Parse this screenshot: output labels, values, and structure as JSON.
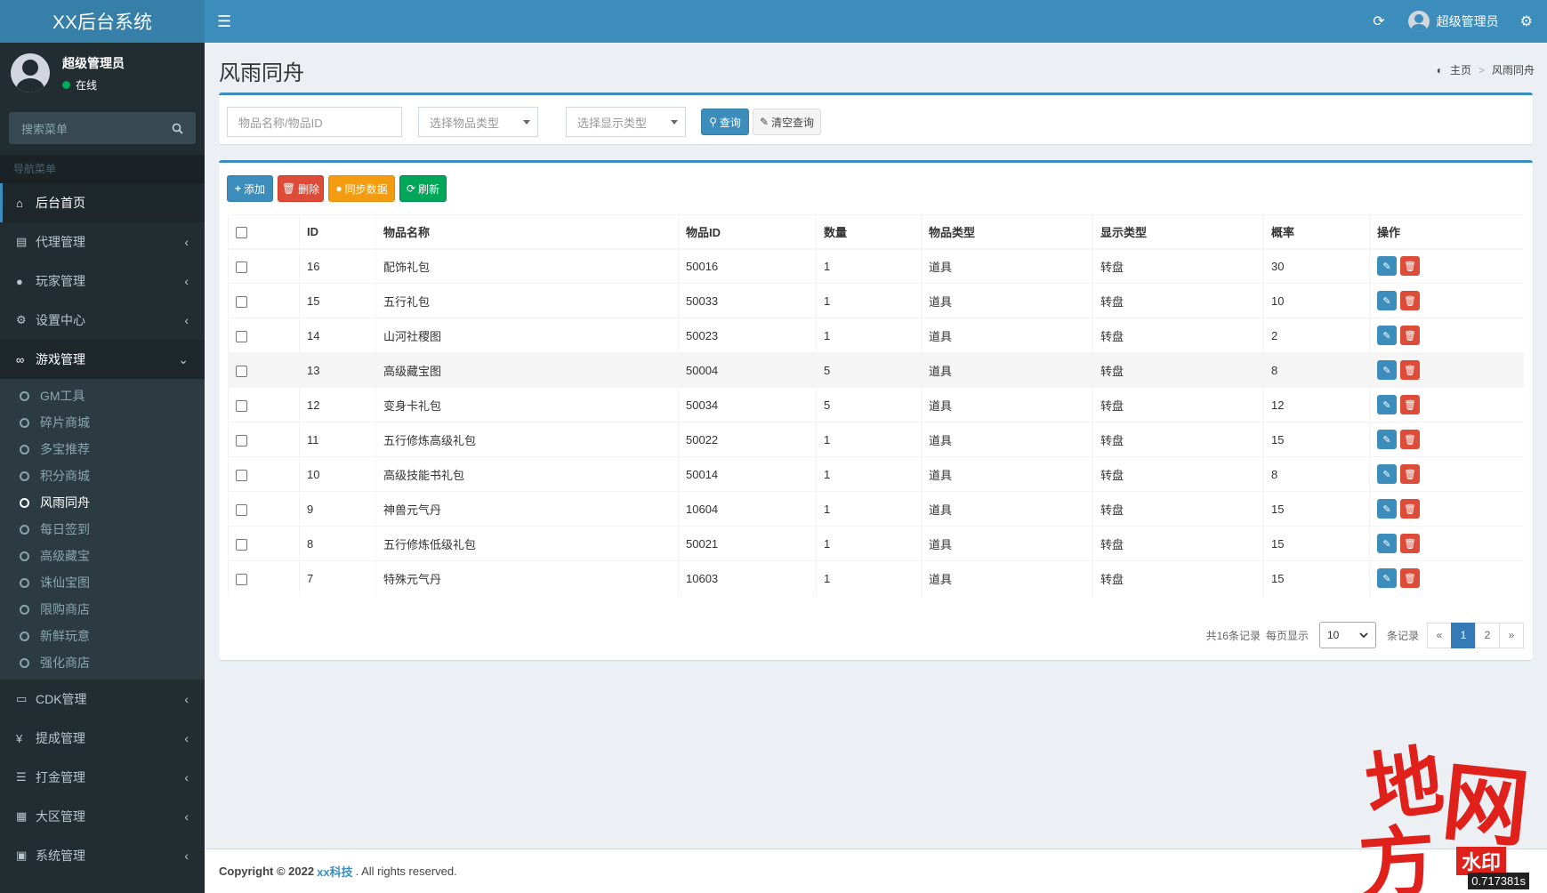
{
  "app": {
    "logo": "XX后台系统"
  },
  "user": {
    "name": "超级管理员",
    "status": "在线"
  },
  "sidebar": {
    "search_placeholder": "搜索菜单",
    "nav_header": "导航菜单",
    "items": [
      {
        "label": "后台首页",
        "icon": "home-icon"
      },
      {
        "label": "代理管理",
        "icon": "id-card-icon"
      },
      {
        "label": "玩家管理",
        "icon": "users-icon"
      },
      {
        "label": "设置中心",
        "icon": "gears-icon"
      },
      {
        "label": "游戏管理",
        "icon": "gamepad-icon"
      }
    ],
    "subitems": [
      "GM工具",
      "碎片商城",
      "多宝推荐",
      "积分商城",
      "风雨同舟",
      "每日签到",
      "高级藏宝",
      "诛仙宝图",
      "限购商店",
      "新鲜玩意",
      "强化商店"
    ],
    "items_after": [
      {
        "label": "CDK管理",
        "icon": "credit-card-icon"
      },
      {
        "label": "提成管理",
        "icon": "yen-icon"
      },
      {
        "label": "打金管理",
        "icon": "list-icon"
      },
      {
        "label": "大区管理",
        "icon": "grid-icon"
      },
      {
        "label": "系统管理",
        "icon": "desktop-icon"
      }
    ]
  },
  "page": {
    "title": "风雨同舟",
    "breadcrumb": {
      "home": "主页",
      "current": "风雨同舟"
    }
  },
  "filters": {
    "name_placeholder": "物品名称/物品ID",
    "type_placeholder": "选择物品类型",
    "display_placeholder": "选择显示类型",
    "query_label": "查询",
    "clear_label": "清空查询"
  },
  "toolbar": {
    "add": "添加",
    "delete": "删除",
    "sync": "同步数据",
    "refresh": "刷新"
  },
  "table": {
    "headers": [
      "ID",
      "物品名称",
      "物品ID",
      "数量",
      "物品类型",
      "显示类型",
      "概率",
      "操作"
    ],
    "rows": [
      [
        "16",
        "配饰礼包",
        "50016",
        "1",
        "道具",
        "转盘",
        "30"
      ],
      [
        "15",
        "五行礼包",
        "50033",
        "1",
        "道具",
        "转盘",
        "10"
      ],
      [
        "14",
        "山河社稷图",
        "50023",
        "1",
        "道具",
        "转盘",
        "2"
      ],
      [
        "13",
        "高级藏宝图",
        "50004",
        "5",
        "道具",
        "转盘",
        "8"
      ],
      [
        "12",
        "变身卡礼包",
        "50034",
        "5",
        "道具",
        "转盘",
        "12"
      ],
      [
        "11",
        "五行修炼高级礼包",
        "50022",
        "1",
        "道具",
        "转盘",
        "15"
      ],
      [
        "10",
        "高级技能书礼包",
        "50014",
        "1",
        "道具",
        "转盘",
        "8"
      ],
      [
        "9",
        "神兽元气丹",
        "10604",
        "1",
        "道具",
        "转盘",
        "15"
      ],
      [
        "8",
        "五行修炼低级礼包",
        "50021",
        "1",
        "道具",
        "转盘",
        "15"
      ],
      [
        "7",
        "特殊元气丹",
        "10603",
        "1",
        "道具",
        "转盘",
        "15"
      ]
    ]
  },
  "pagination": {
    "total_text": "共16条记录",
    "per_page_label": "每页显示",
    "per_page_value": "10",
    "unit": "条记录",
    "prev": "«",
    "pages": [
      "1",
      "2"
    ],
    "next": "»",
    "current": "1"
  },
  "footer": {
    "prefix": "Copyright © 2022",
    "company": "xx科技",
    "suffix": ". All rights reserved."
  },
  "watermark": {
    "chars": [
      "地",
      "网",
      "方"
    ],
    "label": "水印",
    "timer": "0.717381s"
  },
  "colors": {
    "primary": "#3c8dbc",
    "sidebar": "#222d32",
    "danger": "#dd4b39",
    "warning": "#f39c12",
    "success": "#00a65a",
    "watermark": "#e0211b"
  }
}
